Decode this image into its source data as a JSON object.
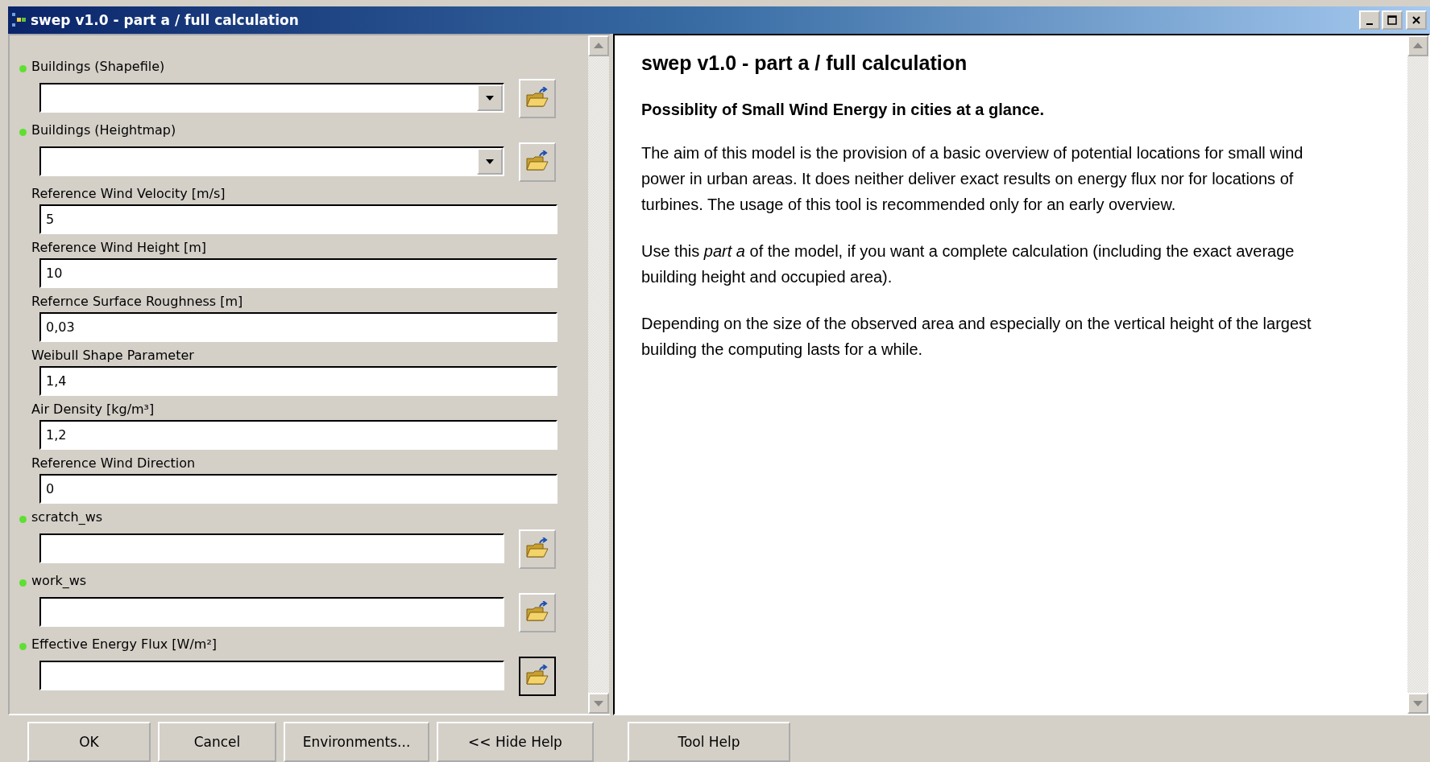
{
  "window": {
    "title": "swep v1.0 - part a / full calculation"
  },
  "parameters": [
    {
      "kind": "combo",
      "label": "Buildings (Shapefile)",
      "required": true,
      "focused": false
    },
    {
      "kind": "combo",
      "label": "Buildings (Heightmap)",
      "required": true,
      "focused": false
    },
    {
      "kind": "text",
      "label": "Reference Wind Velocity [m/s]",
      "required": false,
      "value": "5"
    },
    {
      "kind": "text",
      "label": "Reference Wind Height [m]",
      "required": false,
      "value": "10"
    },
    {
      "kind": "text",
      "label": "Refernce Surface Roughness [m]",
      "required": false,
      "value": "0,03"
    },
    {
      "kind": "text",
      "label": "Weibull Shape Parameter",
      "required": false,
      "value": "1,4"
    },
    {
      "kind": "text",
      "label": "Air Density [kg/m³]",
      "required": false,
      "value": "1,2"
    },
    {
      "kind": "text",
      "label": "Reference Wind Direction",
      "required": false,
      "value": "0"
    },
    {
      "kind": "path",
      "label": "scratch_ws",
      "required": true,
      "focused": false
    },
    {
      "kind": "path",
      "label": "work_ws",
      "required": true,
      "focused": false
    },
    {
      "kind": "path",
      "label": "Effective Energy Flux [W/m²]",
      "required": true,
      "focused": true
    }
  ],
  "help": {
    "title": "swep v1.0 - part a / full calculation",
    "subtitle": "Possiblity of Small Wind Energy in cities at a glance.",
    "paragraphs": [
      "The aim of this model is the provision of a basic overview of potential locations for small wind power in urban areas. It does neither deliver exact results on energy flux nor for locations of turbines. The usage of this tool is recommended only for an early overview.",
      "Use this *part a* of the model, if you want a complete calculation (including the exact average building height and occupied area).",
      "Depending on the size of the observed area and especially on the vertical height of the largest building the computing lasts for a while."
    ]
  },
  "buttons": [
    "OK",
    "Cancel",
    "Environments...",
    "<< Hide Help"
  ],
  "help_button": "Tool Help"
}
